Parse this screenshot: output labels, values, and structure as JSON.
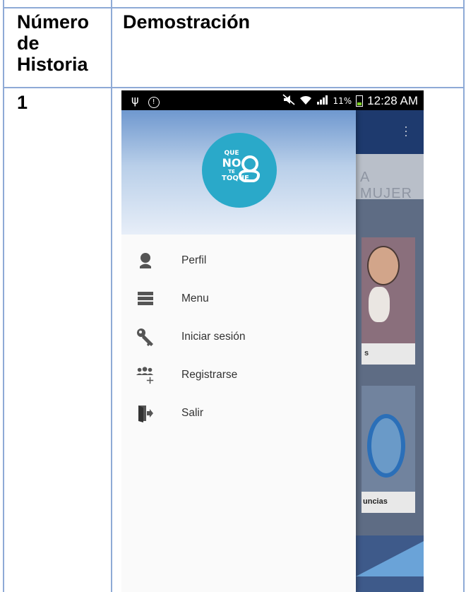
{
  "table": {
    "header_col1": "Número de Historia",
    "header_col2": "Demostración",
    "row1_number": "1"
  },
  "status_bar": {
    "left_icons": [
      "usb-icon",
      "alert-icon"
    ],
    "right_icons": [
      "mute-icon",
      "wifi-icon",
      "signal-icon",
      "battery-icon"
    ],
    "battery_percent": "11%",
    "time": "12:28 AM"
  },
  "background_app": {
    "tab_text": "A MUJER",
    "card1_caption": "s",
    "card2_caption": "uncias"
  },
  "drawer": {
    "logo_text_lines": [
      "QUE",
      "NO",
      "TE",
      "TOQUE"
    ],
    "items": [
      {
        "label": "Perfil",
        "icon": "profile-icon"
      },
      {
        "label": "Menu",
        "icon": "menu-list-icon"
      },
      {
        "label": "Iniciar sesión",
        "icon": "key-icon"
      },
      {
        "label": "Registrarse",
        "icon": "add-user-icon"
      },
      {
        "label": "Salir",
        "icon": "exit-icon"
      }
    ]
  },
  "colors": {
    "table_border": "#8eaad6",
    "logo": "#2aa9c9",
    "app_bar": "#1e3a6e"
  }
}
